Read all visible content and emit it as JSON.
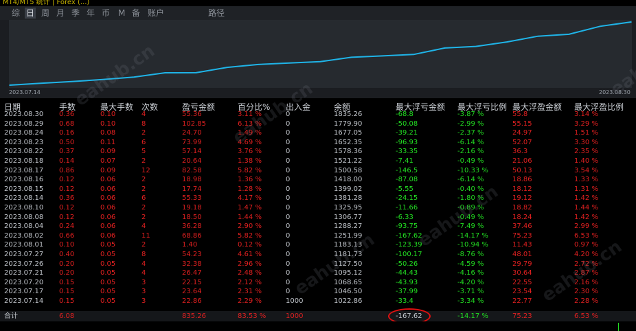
{
  "top_title": "MT4/MT5 统计 | Forex (...)",
  "tabs": [
    {
      "label": "综",
      "active": false
    },
    {
      "label": "日",
      "active": true
    },
    {
      "label": "周",
      "active": false
    },
    {
      "label": "月",
      "active": false
    },
    {
      "label": "季",
      "active": false
    },
    {
      "label": "年",
      "active": false
    },
    {
      "label": "币",
      "active": false
    },
    {
      "label": "M",
      "active": false
    },
    {
      "label": "备",
      "active": false
    },
    {
      "label": "账户",
      "active": false
    },
    {
      "label": "路径",
      "active": false
    }
  ],
  "chart_data": {
    "type": "line",
    "x": [
      "2023.07.14",
      "2023.07.17",
      "2023.07.20",
      "2023.07.21",
      "2023.07.26",
      "2023.07.27",
      "2023.08.01",
      "2023.08.02",
      "2023.08.04",
      "2023.08.08",
      "2023.08.10",
      "2023.08.14",
      "2023.08.15",
      "2023.08.16",
      "2023.08.17",
      "2023.08.18",
      "2023.08.22",
      "2023.08.23",
      "2023.08.24",
      "2023.08.29",
      "2023.08.30"
    ],
    "y": [
      1022.86,
      1046.5,
      1068.65,
      1095.12,
      1127.5,
      1181.73,
      1183.13,
      1251.99,
      1288.27,
      1306.77,
      1325.95,
      1381.28,
      1399.02,
      1418.0,
      1500.58,
      1521.22,
      1578.36,
      1652.35,
      1677.05,
      1779.9,
      1835.26
    ],
    "x_start_label": "2023.07.14",
    "x_end_label": "2023.08.30",
    "color": "#1fb4e8"
  },
  "table": {
    "headers": [
      "日期",
      "手数",
      "最大手数",
      "次数",
      "盈亏金额",
      "百分比%",
      "出入金",
      "余额",
      "最大浮亏金额",
      "最大浮亏比例",
      "最大浮盈金额",
      "最大浮盈比例"
    ],
    "rows": [
      [
        "2023.08.30",
        "0.36",
        "0.10",
        "4",
        "55.36",
        "3.11 %",
        "0",
        "1835.26",
        "-68.8",
        "-3.87 %",
        "55.8",
        "3.14 %"
      ],
      [
        "2023.08.29",
        "0.68",
        "0.10",
        "8",
        "102.85",
        "6.13 %",
        "0",
        "1779.90",
        "-50.08",
        "-2.99 %",
        "55.15",
        "3.29 %"
      ],
      [
        "2023.08.24",
        "0.16",
        "0.08",
        "2",
        "24.70",
        "1.49 %",
        "0",
        "1677.05",
        "-39.21",
        "-2.37 %",
        "24.97",
        "1.51 %"
      ],
      [
        "2023.08.23",
        "0.50",
        "0.11",
        "6",
        "73.99",
        "4.69 %",
        "0",
        "1652.35",
        "-96.93",
        "-6.14 %",
        "52.07",
        "3.30 %"
      ],
      [
        "2023.08.22",
        "0.37",
        "0.09",
        "5",
        "57.14",
        "3.76 %",
        "0",
        "1578.36",
        "-33.35",
        "-2.16 %",
        "36.3",
        "2.35 %"
      ],
      [
        "2023.08.18",
        "0.14",
        "0.07",
        "2",
        "20.64",
        "1.38 %",
        "0",
        "1521.22",
        "-7.41",
        "-0.49 %",
        "21.06",
        "1.40 %"
      ],
      [
        "2023.08.17",
        "0.86",
        "0.09",
        "12",
        "82.58",
        "5.82 %",
        "0",
        "1500.58",
        "-146.5",
        "-10.33 %",
        "50.13",
        "3.54 %"
      ],
      [
        "2023.08.16",
        "0.12",
        "0.06",
        "2",
        "18.98",
        "1.36 %",
        "0",
        "1418.00",
        "-87.08",
        "-6.14 %",
        "18.86",
        "1.33 %"
      ],
      [
        "2023.08.15",
        "0.12",
        "0.06",
        "2",
        "17.74",
        "1.28 %",
        "0",
        "1399.02",
        "-5.55",
        "-0.40 %",
        "18.12",
        "1.31 %"
      ],
      [
        "2023.08.14",
        "0.36",
        "0.06",
        "6",
        "55.33",
        "4.17 %",
        "0",
        "1381.28",
        "-24.15",
        "-1.80 %",
        "19.12",
        "1.42 %"
      ],
      [
        "2023.08.10",
        "0.12",
        "0.06",
        "2",
        "19.18",
        "1.47 %",
        "0",
        "1325.95",
        "-11.66",
        "-0.89 %",
        "18.82",
        "1.44 %"
      ],
      [
        "2023.08.08",
        "0.12",
        "0.06",
        "2",
        "18.50",
        "1.44 %",
        "0",
        "1306.77",
        "-6.33",
        "-0.49 %",
        "18.24",
        "1.42 %"
      ],
      [
        "2023.08.04",
        "0.24",
        "0.06",
        "4",
        "36.28",
        "2.90 %",
        "0",
        "1288.27",
        "-93.75",
        "-7.49 %",
        "37.46",
        "2.99 %"
      ],
      [
        "2023.08.02",
        "0.66",
        "0.06",
        "11",
        "68.86",
        "5.82 %",
        "0",
        "1251.99",
        "-167.62",
        "-14.17 %",
        "75.23",
        "6.53 %"
      ],
      [
        "2023.08.01",
        "0.10",
        "0.05",
        "2",
        "1.40",
        "0.12 %",
        "0",
        "1183.13",
        "-123.39",
        "-10.94 %",
        "11.43",
        "0.97 %"
      ],
      [
        "2023.07.27",
        "0.40",
        "0.05",
        "8",
        "54.23",
        "4.61 %",
        "0",
        "1181.73",
        "-100.17",
        "-8.76 %",
        "48.01",
        "4.20 %"
      ],
      [
        "2023.07.26",
        "0.20",
        "0.05",
        "4",
        "32.38",
        "2.96 %",
        "0",
        "1127.50",
        "-50.26",
        "-4.59 %",
        "29.79",
        "2.72 %"
      ],
      [
        "2023.07.21",
        "0.20",
        "0.05",
        "4",
        "26.47",
        "2.48 %",
        "0",
        "1095.12",
        "-44.43",
        "-4.16 %",
        "30.64",
        "2.87 %"
      ],
      [
        "2023.07.20",
        "0.15",
        "0.05",
        "3",
        "22.15",
        "2.12 %",
        "0",
        "1068.65",
        "-43.93",
        "-4.20 %",
        "22.55",
        "2.16 %"
      ],
      [
        "2023.07.17",
        "0.15",
        "0.05",
        "3",
        "23.64",
        "2.31 %",
        "0",
        "1046.50",
        "-37.99",
        "-3.71 %",
        "23.54",
        "2.30 %"
      ],
      [
        "2023.07.14",
        "0.15",
        "0.05",
        "3",
        "22.86",
        "2.29 %",
        "1000",
        "1022.86",
        "-33.4",
        "-3.34 %",
        "22.77",
        "2.28 %"
      ]
    ],
    "total": [
      "合计",
      "6.08",
      "",
      "",
      "835.26",
      "83.53 %",
      "1000",
      "",
      "-167.62",
      "-14.17 %",
      "75.23",
      "6.53 %"
    ]
  },
  "watermark": "eahub.cn",
  "colors": {
    "profit": "#e02020",
    "loss": "#22dd22",
    "neutral": "#c0c4ca",
    "highlight": "#e01010"
  }
}
